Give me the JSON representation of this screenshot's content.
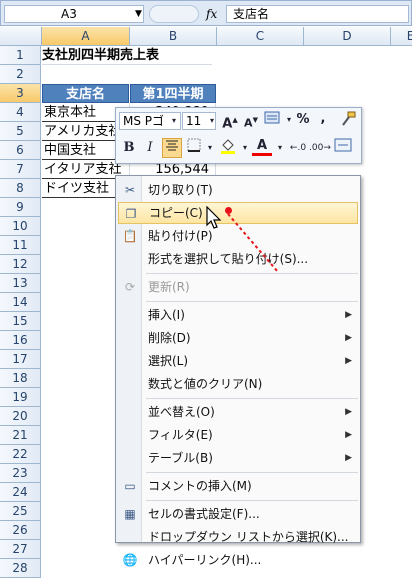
{
  "formula_bar": {
    "name_box": "A3",
    "fx": "fx",
    "formula": "支店名"
  },
  "columns": [
    "A",
    "B",
    "C",
    "D",
    "E"
  ],
  "rows": [
    "1",
    "2",
    "3",
    "4",
    "5",
    "6",
    "7",
    "8",
    "9",
    "10",
    "11",
    "12",
    "13",
    "14",
    "15",
    "16",
    "17",
    "18",
    "19",
    "20",
    "21",
    "22",
    "23",
    "24",
    "25",
    "26",
    "27",
    "28"
  ],
  "sheet": {
    "title": "支社別四半期売上表",
    "header_branch": "支店名",
    "header_q1": "第1四半期",
    "branches": [
      "東京本社",
      "アメリカ支社",
      "中国支社",
      "イタリア支社",
      "ドイツ支社"
    ],
    "q1_visible": [
      "349,889",
      "156,544"
    ]
  },
  "mini_toolbar": {
    "font_name": "MS Pゴ",
    "font_size": "11",
    "row1": [
      "grow-font",
      "shrink-font",
      "format-style",
      "percent",
      "comma",
      "format-painter"
    ],
    "row2": [
      "bold",
      "italic",
      "center",
      "borders",
      "fill-color",
      "font-color",
      "increase-decimal",
      "decrease-decimal",
      "merge"
    ],
    "labels": {
      "bold": "B",
      "italic": "I",
      "percent": "%",
      "comma": ",",
      "grow": "A",
      "shrink": "A"
    }
  },
  "context_menu": [
    {
      "label": "切り取り(T)",
      "icon": "scissors-icon"
    },
    {
      "label": "コピー(C)",
      "icon": "copy-icon",
      "highlighted": true
    },
    {
      "label": "貼り付け(P)",
      "icon": "paste-icon"
    },
    {
      "label": "形式を選択して貼り付け(S)..."
    },
    {
      "separator": true
    },
    {
      "label": "更新(R)",
      "icon": "refresh-icon",
      "disabled": true
    },
    {
      "separator": true
    },
    {
      "label": "挿入(I)",
      "submenu": true
    },
    {
      "label": "削除(D)",
      "submenu": true
    },
    {
      "label": "選択(L)",
      "submenu": true
    },
    {
      "label": "数式と値のクリア(N)"
    },
    {
      "separator": true
    },
    {
      "label": "並べ替え(O)",
      "submenu": true
    },
    {
      "label": "フィルタ(E)",
      "submenu": true
    },
    {
      "label": "テーブル(B)",
      "submenu": true
    },
    {
      "separator": true
    },
    {
      "label": "コメントの挿入(M)",
      "icon": "comment-icon"
    },
    {
      "separator": true
    },
    {
      "label": "セルの書式設定(F)...",
      "icon": "format-cells-icon"
    },
    {
      "label": "ドロップダウン リストから選択(K)..."
    },
    {
      "label": "ハイパーリンク(H)...",
      "icon": "hyperlink-icon"
    }
  ],
  "colors": {
    "header_fill": "#4f81bd",
    "highlight": "#fde5a2",
    "annotation": "#e8121b"
  }
}
